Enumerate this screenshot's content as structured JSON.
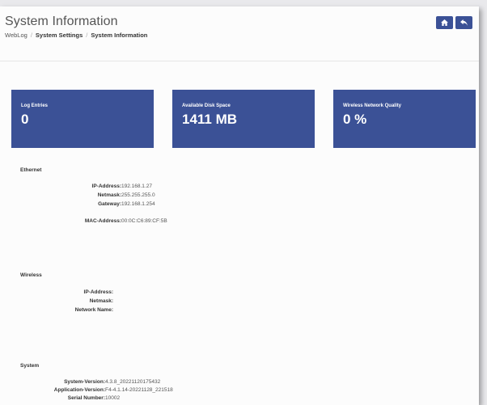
{
  "header": {
    "title": "System Information",
    "breadcrumb": [
      "WebLog",
      "System Settings",
      "System Information"
    ],
    "buttons": [
      {
        "icon": "home-icon"
      },
      {
        "icon": "back-icon"
      }
    ]
  },
  "cards": [
    {
      "label": "Log Entries",
      "value": "0"
    },
    {
      "label": "Available Disk Space",
      "value": "1411 MB"
    },
    {
      "label": "Wireless Network Quality",
      "value": "0 %"
    }
  ],
  "ethernet": {
    "title": "Ethernet",
    "ip_label": "IP-Address:",
    "ip": "192.168.1.27",
    "netmask_label": "Netmask:",
    "netmask": "255.255.255.0",
    "gateway_label": "Gateway:",
    "gateway": "192.168.1.254",
    "mac_label": "MAC-Address:",
    "mac": "00:0C:C6:89:CF:5B"
  },
  "wireless": {
    "title": "Wireless",
    "ip_label": "IP-Address:",
    "ip": "",
    "netmask_label": "Netmask:",
    "netmask": "",
    "network_label": "Network Name:",
    "network": ""
  },
  "system": {
    "title": "System",
    "version_label": "System-Version:",
    "version": "4.3.8_20221120175432",
    "app_label": "Application-Version:",
    "app": "F4-4.1.14-20221128_221518",
    "serial_label": "Serial Number:",
    "serial": "10002"
  },
  "colors": {
    "accent": "#3b5196"
  }
}
